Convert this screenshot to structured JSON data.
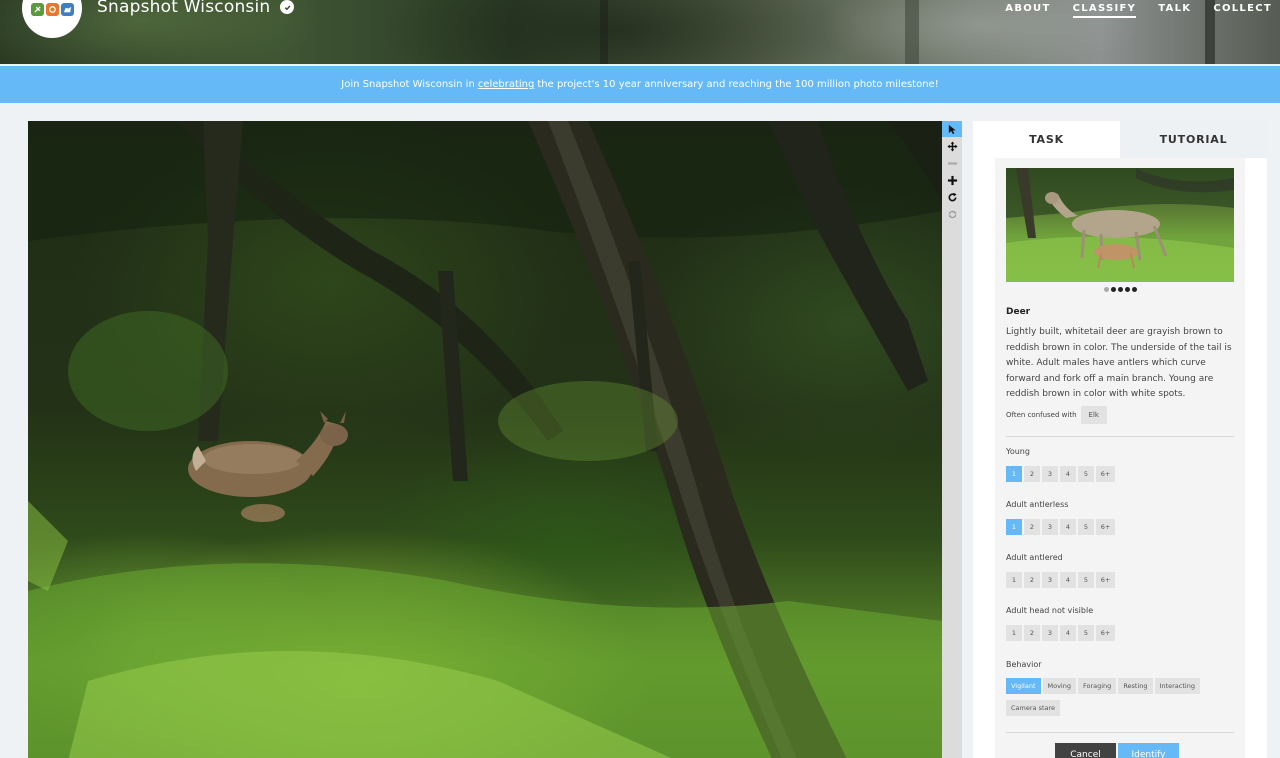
{
  "header": {
    "project_title": "Snapshot Wisconsin",
    "nav": [
      "ABOUT",
      "CLASSIFY",
      "TALK",
      "COLLECT"
    ],
    "active_nav": "CLASSIFY",
    "logo_colors": [
      "#5a9a3c",
      "#e8772c",
      "#3f7fc1"
    ]
  },
  "banner": {
    "prefix": "Join Snapshot Wisconsin in",
    "link": "celebrating",
    "suffix": "the project's 10 year anniversary and reaching the 100 million photo milestone!"
  },
  "toolbar": {
    "tools": [
      "cursor-icon",
      "move-icon",
      "zoom-out-icon",
      "zoom-in-icon",
      "rotate-icon",
      "reset-icon"
    ],
    "active_tool": "cursor-icon"
  },
  "tabs": [
    "TASK",
    "TUTORIAL"
  ],
  "species": {
    "name": "Deer",
    "description": "Lightly built, whitetail deer are grayish brown to reddish brown in color. The underside of the tail is white. Adult males have antlers which curve forward and fork off a main branch. Young are reddish brown in color with white spots.",
    "confused_label": "Often confused with",
    "confused_with": "Elk",
    "image_count": 5,
    "active_image": 0
  },
  "questions": [
    {
      "label": "Young",
      "options": [
        "1",
        "2",
        "3",
        "4",
        "5",
        "6+"
      ],
      "selected": "1"
    },
    {
      "label": "Adult antlerless",
      "options": [
        "1",
        "2",
        "3",
        "4",
        "5",
        "6+"
      ],
      "selected": "1"
    },
    {
      "label": "Adult antlered",
      "options": [
        "1",
        "2",
        "3",
        "4",
        "5",
        "6+"
      ],
      "selected": null
    },
    {
      "label": "Adult head not visible",
      "options": [
        "1",
        "2",
        "3",
        "4",
        "5",
        "6+"
      ],
      "selected": null
    }
  ],
  "behavior": {
    "label": "Behavior",
    "options_row1": [
      "Vigilant",
      "Moving",
      "Foraging",
      "Resting",
      "Interacting"
    ],
    "options_row2": [
      "Camera stare"
    ],
    "selected": [
      "Vigilant"
    ]
  },
  "actions": {
    "cancel": "Cancel",
    "identify": "Identify"
  },
  "colors": {
    "accent": "#65b9f6",
    "cancel": "#424242"
  }
}
